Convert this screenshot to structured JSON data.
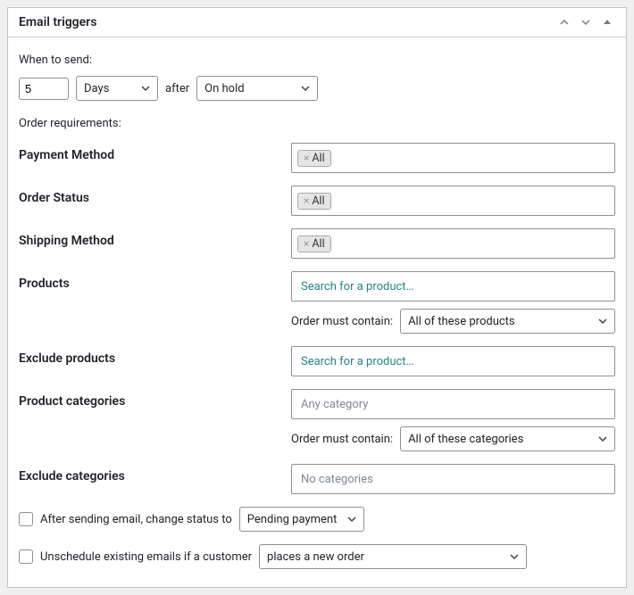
{
  "panel": {
    "title": "Email triggers"
  },
  "whenToSend": {
    "heading": "When to send:",
    "value": "5",
    "unit": "Days",
    "afterText": "after",
    "afterStatus": "On hold"
  },
  "orderRequirements": {
    "heading": "Order requirements:",
    "paymentMethod": {
      "label": "Payment Method",
      "token": "All"
    },
    "orderStatus": {
      "label": "Order Status",
      "token": "All"
    },
    "shippingMethod": {
      "label": "Shipping Method",
      "token": "All"
    },
    "products": {
      "label": "Products",
      "placeholder": "Search for a product…",
      "mustContainLabel": "Order must contain:",
      "mustContainValue": "All of these products"
    },
    "excludeProducts": {
      "label": "Exclude products",
      "placeholder": "Search for a product…"
    },
    "productCategories": {
      "label": "Product categories",
      "placeholder": "Any category",
      "mustContainLabel": "Order must contain:",
      "mustContainValue": "All of these categories"
    },
    "excludeCategories": {
      "label": "Exclude categories",
      "placeholder": "No categories"
    }
  },
  "afterSending": {
    "label": "After sending email, change status to",
    "value": "Pending payment"
  },
  "unschedule": {
    "label": "Unschedule existing emails if a customer",
    "value": "places a new order"
  }
}
